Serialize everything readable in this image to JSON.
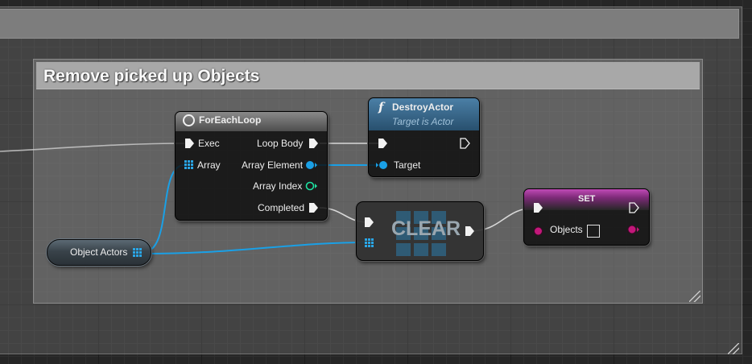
{
  "comment": {
    "title": "Remove picked up Objects"
  },
  "foreach": {
    "title": "ForEachLoop",
    "exec": "Exec",
    "array": "Array",
    "loop_body": "Loop Body",
    "array_element": "Array Element",
    "array_index": "Array Index",
    "completed": "Completed"
  },
  "destroy": {
    "title": "DestroyActor",
    "subtitle": "Target is Actor",
    "target": "Target",
    "func_symbol": "f"
  },
  "clear": {
    "label": "CLEAR"
  },
  "set": {
    "title": "SET",
    "objects": "Objects"
  },
  "variable": {
    "label": "Object Actors"
  },
  "colors": {
    "exec_wire": "#d8d8d8",
    "object_wire": "#1aa0e6",
    "object_pin": "#1aa0e6",
    "int_pin": "#1ee0a0",
    "set_pin": "#c2187a",
    "set_header": "#b03aa6",
    "destroy_header": "#3a6a8c"
  },
  "icons": {
    "loop": "loop-icon",
    "function": "function-icon",
    "array": "array-grid-icon",
    "resize": "resize-grip-icon"
  }
}
